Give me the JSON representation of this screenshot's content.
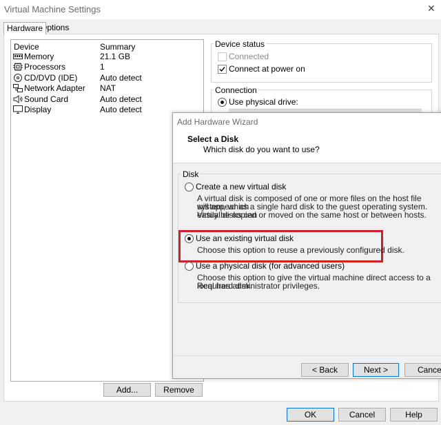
{
  "window": {
    "title": "Virtual Machine Settings"
  },
  "tabs": [
    {
      "label": "Hardware"
    },
    {
      "label": "Options"
    }
  ],
  "device_list": {
    "columns": [
      "Device",
      "Summary"
    ],
    "rows": [
      {
        "name": "Memory",
        "summary": "21.1 GB",
        "icon": "memory-icon"
      },
      {
        "name": "Processors",
        "summary": "1",
        "icon": "processor-icon"
      },
      {
        "name": "CD/DVD (IDE)",
        "summary": "Auto detect",
        "icon": "cd-dvd-icon"
      },
      {
        "name": "Network Adapter",
        "summary": "NAT",
        "icon": "network-adapter-icon"
      },
      {
        "name": "Sound Card",
        "summary": "Auto detect",
        "icon": "speaker-icon"
      },
      {
        "name": "Display",
        "summary": "Auto detect",
        "icon": "monitor-icon"
      }
    ]
  },
  "device_status": {
    "label": "Device status",
    "connected": {
      "label": "Connected",
      "checked": false,
      "enabled": false
    },
    "connect_at_power_on": {
      "label": "Connect at power on",
      "checked": true
    }
  },
  "connection": {
    "label": "Connection",
    "use_physical_drive": {
      "label": "Use physical drive:",
      "selected": true
    }
  },
  "buttons": {
    "add": "Add...",
    "remove": "Remove",
    "ok": "OK",
    "cancel": "Cancel",
    "help": "Help"
  },
  "wizard": {
    "title": "Add Hardware Wizard",
    "heading": "Select a Disk",
    "subheading": "Which disk do you want to use?",
    "group_label": "Disk",
    "options": [
      {
        "label": "Create a new virtual disk",
        "description": [
          "A virtual disk is composed of one or more files on the host file system, which",
          "will appear as a single hard disk to the guest operating system. Virtual disks can",
          "easily be copied or moved on the same host or between hosts."
        ],
        "selected": false
      },
      {
        "label": "Use an existing virtual disk",
        "description": [
          "Choose this option to reuse a previously configured disk."
        ],
        "selected": true
      },
      {
        "label": "Use a physical disk (for advanced users)",
        "description": [
          "Choose this option to give the virtual machine direct access to a local hard disk.",
          "Requires administrator privileges."
        ],
        "selected": false
      }
    ],
    "buttons": {
      "back": "< Back",
      "next": "Next >",
      "cancel": "Cancel"
    }
  },
  "colors": {
    "highlight": "#d21f26",
    "default_button_border": "#0078d7"
  }
}
